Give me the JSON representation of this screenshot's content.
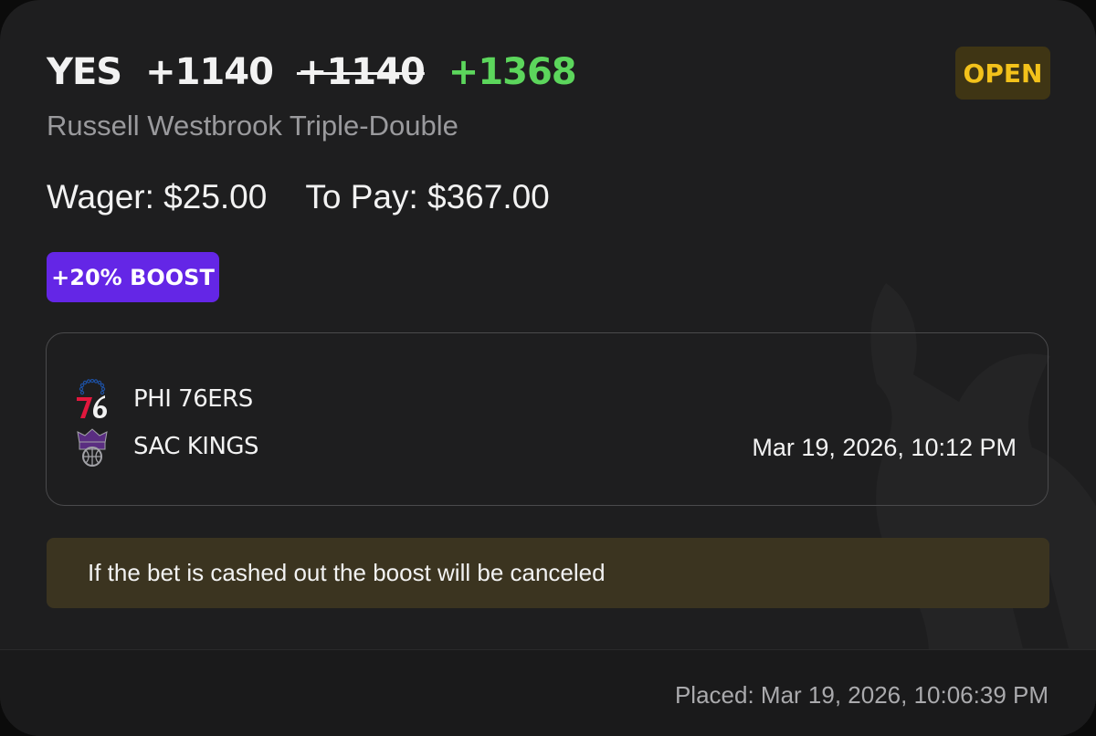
{
  "bet": {
    "selection": "YES",
    "odds_original": "+1140",
    "odds_struck": "+1140",
    "odds_boosted": "+1368",
    "status": "OPEN",
    "market": "Russell Westbrook Triple-Double",
    "wager_text": "Wager: $25.00",
    "to_pay_text": "To Pay: $367.00",
    "boost_label": "+20% BOOST"
  },
  "event": {
    "home_team": "PHI 76ERS",
    "away_team": "SAC KINGS",
    "home_logo_icon": "76ers-logo-icon",
    "away_logo_icon": "kings-logo-icon",
    "start_time": "Mar 19, 2026, 10:12 PM"
  },
  "notice": "If the bet is cashed out the boost will be canceled",
  "footer": {
    "placed": "Placed: Mar 19, 2026, 10:06:39 PM"
  },
  "colors": {
    "card_bg": "#1e1e1f",
    "boosted_odds": "#5cd65c",
    "status_text": "#f3c21b",
    "status_bg": "#3f3514",
    "boost_bg": "#6426e6",
    "notice_bg": "#3b3420"
  }
}
